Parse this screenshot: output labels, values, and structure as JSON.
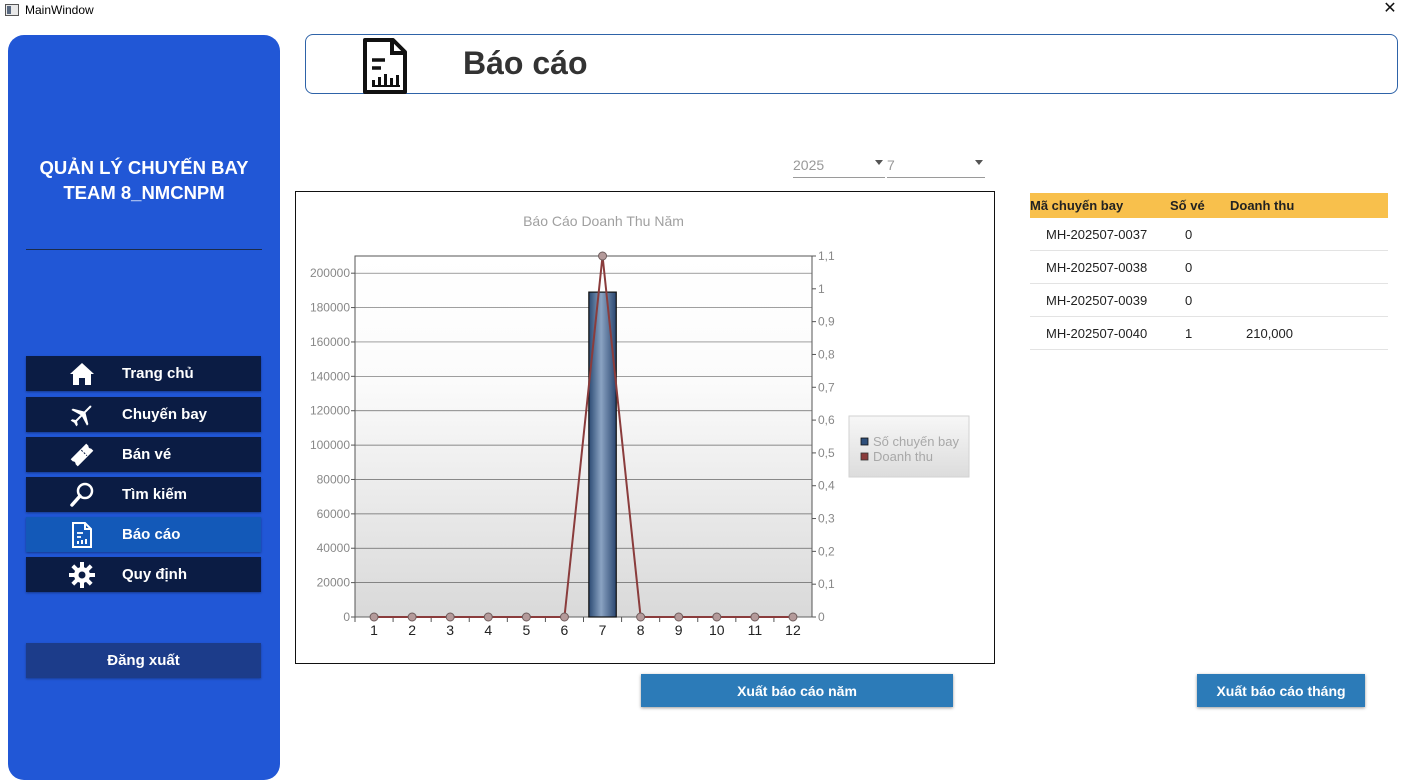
{
  "window": {
    "title": "MainWindow",
    "close_glyph": "✕"
  },
  "sidebar": {
    "app_title_line1": "QUẢN LÝ CHUYẾN BAY",
    "app_title_line2": "TEAM 8_NMCNPM",
    "items": [
      {
        "label": "Trang chủ",
        "icon": "home-icon"
      },
      {
        "label": "Chuyến bay",
        "icon": "airplane-icon"
      },
      {
        "label": "Bán vé",
        "icon": "ticket-icon"
      },
      {
        "label": "Tìm kiếm",
        "icon": "search-icon"
      },
      {
        "label": "Báo cáo",
        "icon": "report-icon",
        "active": true
      },
      {
        "label": "Quy định",
        "icon": "gear-icon"
      }
    ],
    "logout_label": "Đăng xuất"
  },
  "header": {
    "title": "Báo cáo",
    "icon": "report-document-icon"
  },
  "filters": {
    "year": "2025",
    "month": "7"
  },
  "chart_data": {
    "type": "bar",
    "title": "Báo Cáo Doanh Thu Năm",
    "categories": [
      "1",
      "2",
      "3",
      "4",
      "5",
      "6",
      "7",
      "8",
      "9",
      "10",
      "11",
      "12"
    ],
    "series": [
      {
        "name": "Số chuyến bay",
        "type": "bar",
        "axis": "left",
        "values": [
          0,
          0,
          0,
          0,
          0,
          0,
          189000,
          0,
          0,
          0,
          0,
          0
        ],
        "color": "#2e4f7a"
      },
      {
        "name": "Doanh thu",
        "type": "line",
        "axis": "right",
        "values": [
          0,
          0,
          0,
          0,
          0,
          0,
          1.1,
          0,
          0,
          0,
          0,
          0
        ],
        "color": "#8a3c3c"
      }
    ],
    "y_left": {
      "min": 0,
      "max": 210000,
      "ticks": [
        "0",
        "20000",
        "40000",
        "60000",
        "80000",
        "100000",
        "120000",
        "140000",
        "160000",
        "180000",
        "200000"
      ]
    },
    "y_right": {
      "min": 0,
      "max": 1.1,
      "ticks": [
        "0",
        "0,1",
        "0,2",
        "0,3",
        "0,4",
        "0,5",
        "0,6",
        "0,7",
        "0,8",
        "0,9",
        "1",
        "1,1"
      ]
    },
    "legend_position": "right",
    "grid": true
  },
  "table": {
    "headers": [
      "Mã chuyến bay",
      "Số vé",
      "Doanh thu"
    ],
    "rows": [
      {
        "code": "MH-202507-0037",
        "tickets": "0",
        "revenue": ""
      },
      {
        "code": "MH-202507-0038",
        "tickets": "0",
        "revenue": ""
      },
      {
        "code": "MH-202507-0039",
        "tickets": "0",
        "revenue": ""
      },
      {
        "code": "MH-202507-0040",
        "tickets": "1",
        "revenue": "210,000"
      }
    ]
  },
  "buttons": {
    "export_year": "Xuất báo cáo năm",
    "export_month": "Xuất báo cáo tháng"
  }
}
